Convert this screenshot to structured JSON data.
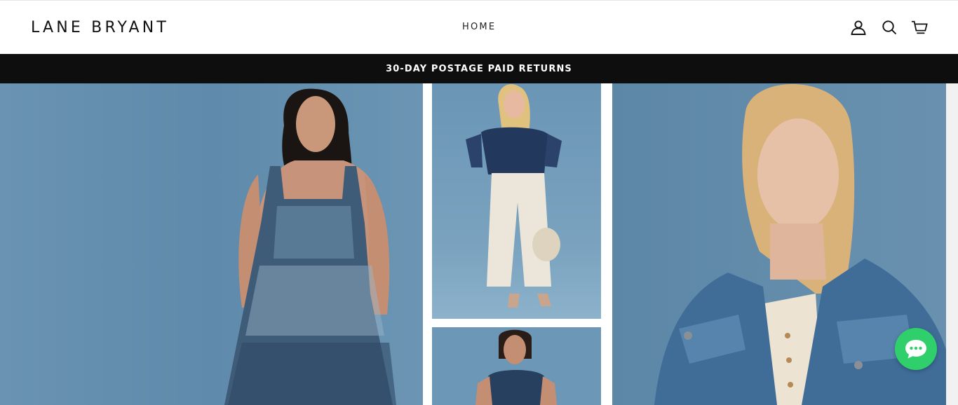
{
  "header": {
    "logo_text": "LANE BRYANT",
    "nav": [
      {
        "label": "HOME"
      }
    ],
    "icons": [
      "account-icon",
      "search-icon",
      "cart-icon"
    ]
  },
  "promo_bar": {
    "text": "30-DAY POSTAGE PAID RETURNS"
  },
  "hero": {
    "panels": [
      "model-left-dress",
      "model-mid-top-outfit",
      "model-mid-bottom-outfit",
      "model-right-denim-jacket"
    ]
  },
  "chat": {
    "icon": "chat-bubble-icon",
    "color": "#2fd06b"
  },
  "colors": {
    "promo_bg": "#0e0e0e",
    "hero_bg": "#5f8aa8"
  }
}
